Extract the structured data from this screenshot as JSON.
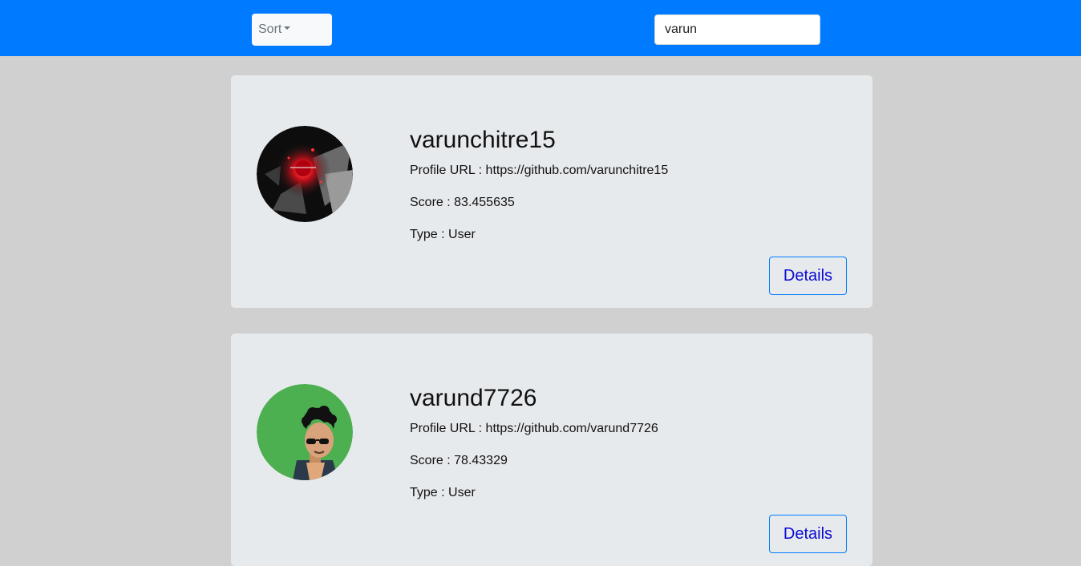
{
  "header": {
    "sort_label": "Sort",
    "search_value": "varun"
  },
  "results": [
    {
      "username": "varunchitre15",
      "profile_url_label": "Profile URL : ",
      "profile_url": "https://github.com/varunchitre15",
      "score_label": "Score : ",
      "score": "83.455635",
      "type_label": "Type : ",
      "type": "User",
      "details_label": "Details"
    },
    {
      "username": "varund7726",
      "profile_url_label": "Profile URL : ",
      "profile_url": "https://github.com/varund7726",
      "score_label": "Score : ",
      "score": "78.43329",
      "type_label": "Type : ",
      "type": "User",
      "details_label": "Details"
    }
  ],
  "colors": {
    "navbar": "#007bff",
    "page_bg": "#d0d0d0",
    "card_bg": "#e7eaed",
    "avatar2_bg": "#4caf50"
  }
}
